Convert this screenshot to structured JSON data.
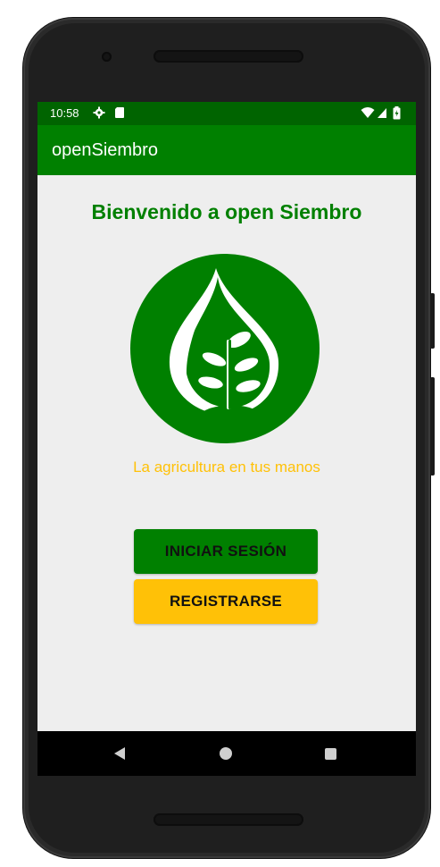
{
  "status_bar": {
    "time": "10:58",
    "icons": [
      "settings-icon",
      "sd-card-icon",
      "wifi-icon",
      "signal-icon",
      "battery-icon"
    ]
  },
  "app_bar": {
    "title": "openSiembro"
  },
  "main": {
    "welcome_title": "Bienvenido a open Siembro",
    "logo_icon": "water-drop-plant-icon",
    "tagline": "La agricultura en tus manos",
    "login_button": "INICIAR SESIÓN",
    "register_button": "REGISTRARSE"
  },
  "nav_bar": {
    "icons": [
      "back-icon",
      "home-icon",
      "recents-icon"
    ]
  },
  "colors": {
    "status_bar": "#006400",
    "primary": "#008000",
    "accent": "#ffc107",
    "background": "#eeeeee"
  }
}
